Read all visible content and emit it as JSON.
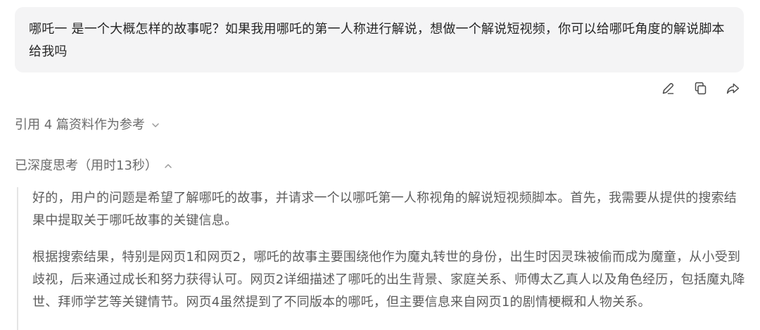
{
  "user_message": {
    "text": "哪吒一 是一个大概怎样的故事呢？如果我用哪吒的第一人称进行解说，想做一个解说短视频，你可以给哪吒角度的解说脚本给我吗"
  },
  "message_actions": [
    {
      "icon": "edit-icon"
    },
    {
      "icon": "copy-icon"
    },
    {
      "icon": "share-icon"
    }
  ],
  "references": {
    "label": "引用 4 篇资料作为参考",
    "icon": "chevron-down-icon"
  },
  "thinking": {
    "label": "已深度思考（用时13秒）",
    "icon": "chevron-up-icon",
    "paragraphs": [
      "好的，用户的问题是希望了解哪吒的故事，并请求一个以哪吒第一人称视角的解说短视频脚本。首先，我需要从提供的搜索结果中提取关于哪吒故事的关键信息。",
      "根据搜索结果，特别是网页1和网页2，哪吒的故事主要围绕他作为魔丸转世的身份，出生时因灵珠被偷而成为魔童，从小受到歧视，后来通过成长和努力获得认可。网页2详细描述了哪吒的出生背景、家庭关系、师傅太乙真人以及角色经历，包括魔丸降世、拜师学艺等关键情节。网页4虽然提到了不同版本的哪吒，但主要信息来自网页1的剧情梗概和人物关系。"
    ]
  }
}
